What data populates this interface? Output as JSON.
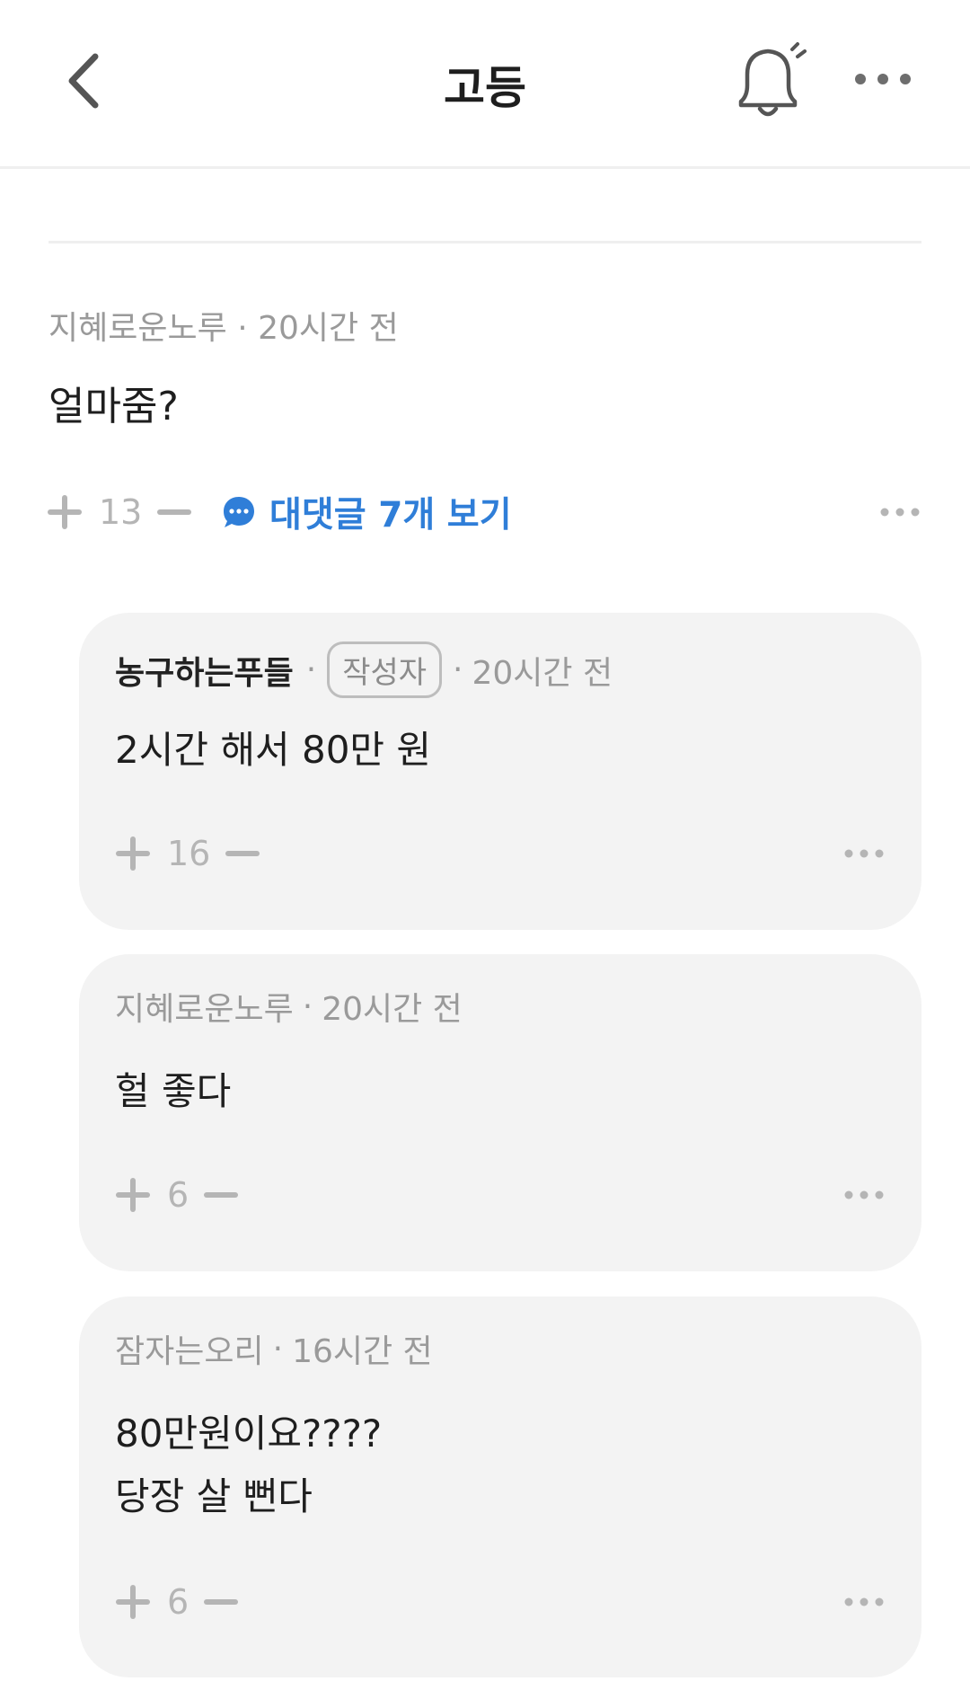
{
  "header": {
    "title": "고등",
    "back_icon": "chevron-left-icon",
    "bell_icon": "bell-icon",
    "more_icon": "more-horizontal-icon"
  },
  "comment": {
    "author": "지혜로운노루",
    "time": "20시간 전",
    "body": "얼마줌?",
    "votes": "13",
    "replies_label": "대댓글 7개 보기",
    "accent_color": "#2f7ed8"
  },
  "replies": [
    {
      "author": "농구하는푸들",
      "badge": "작성자",
      "time": "20시간 전",
      "body": "2시간 해서 80만 원",
      "votes": "16"
    },
    {
      "author": "지혜로운노루",
      "time": "20시간 전",
      "body": "헐 좋다",
      "votes": "6"
    },
    {
      "author": "잠자는오리",
      "time": "16시간 전",
      "body": "80만원이요????\n당장 살 뻔다",
      "votes": "6"
    }
  ],
  "separator": "·"
}
